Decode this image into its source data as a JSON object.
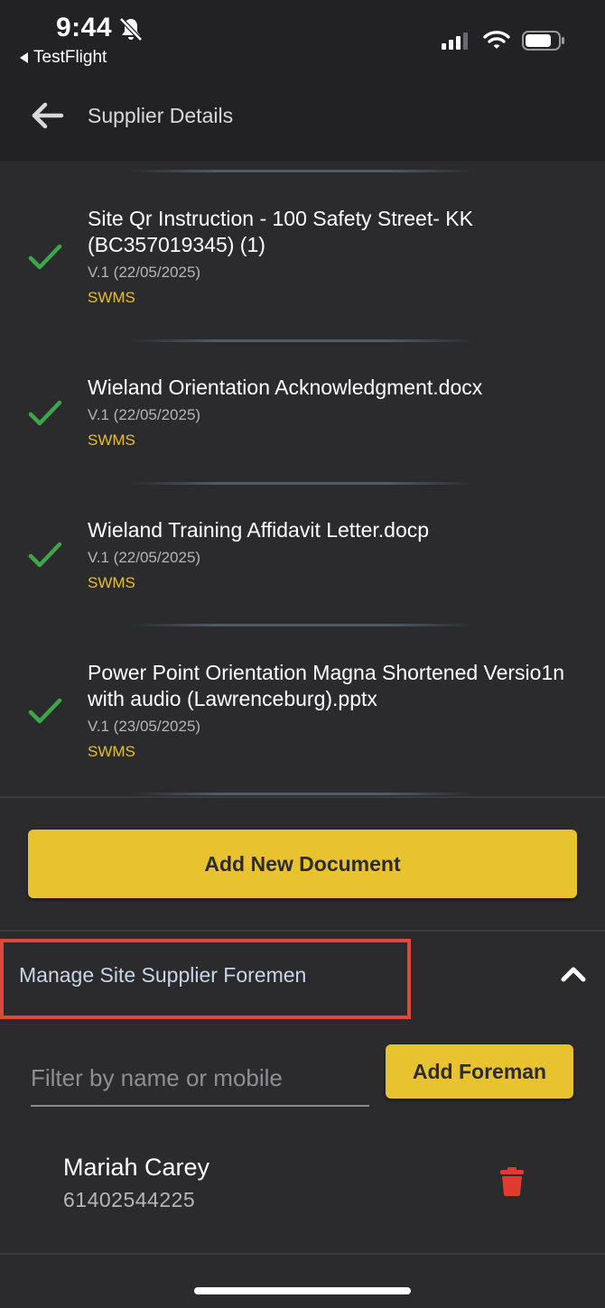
{
  "status_bar": {
    "time": "9:44",
    "back_app": "TestFlight"
  },
  "header": {
    "title": "Supplier Details"
  },
  "documents": [
    {
      "title": "Site Qr Instruction - 100 Safety Street- KK (BC357019345) (1)",
      "version": "V.1 (22/05/2025)",
      "type": "SWMS"
    },
    {
      "title": "Wieland Orientation Acknowledgment.docx",
      "version": "V.1 (22/05/2025)",
      "type": "SWMS"
    },
    {
      "title": "Wieland Training Affidavit Letter.docp",
      "version": "V.1 (22/05/2025)",
      "type": "SWMS"
    },
    {
      "title": "Power Point Orientation Magna Shortened Versio1n with audio (Lawrenceburg).pptx",
      "version": "V.1 (23/05/2025)",
      "type": "SWMS"
    }
  ],
  "add_document_label": "Add New Document",
  "foremen_section": {
    "title": "Manage Site Supplier Foremen",
    "filter_placeholder": "Filter by name or mobile",
    "filter_value": "",
    "add_foreman_label": "Add Foreman",
    "foremen": [
      {
        "name": "Mariah Carey",
        "mobile": "61402544225"
      }
    ]
  },
  "colors": {
    "accent": "#e9c22f",
    "check": "#3ea64a",
    "delete": "#e13b30",
    "highlight": "#e0483e",
    "background": "#2b2b2d",
    "topbar": "#222224"
  },
  "icons": {
    "back": "arrow-left-icon",
    "check": "checkmark-icon",
    "collapse": "chevron-up-icon",
    "delete": "trash-icon",
    "silent": "bell-slash-icon",
    "signal": "cellular-signal-icon",
    "wifi": "wifi-icon",
    "battery": "battery-icon"
  }
}
